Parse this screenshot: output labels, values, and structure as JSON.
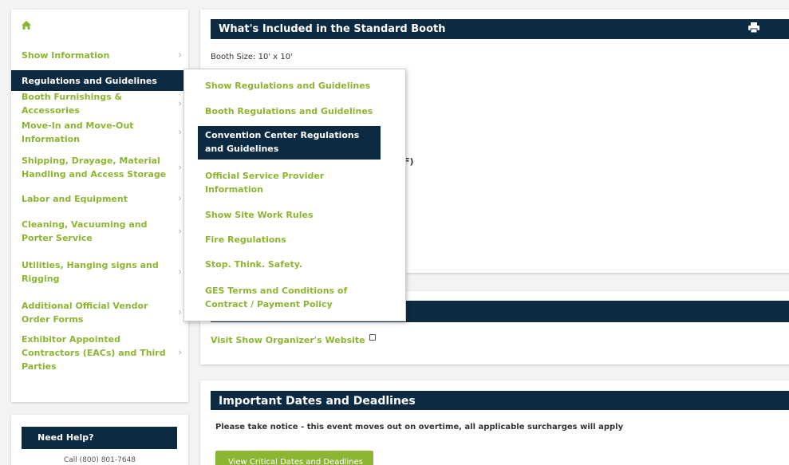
{
  "sidebar": {
    "home_icon": "home-icon",
    "items": [
      {
        "label": "Show Information"
      },
      {
        "label": "Regulations and Guidelines"
      },
      {
        "label": "Booth Furnishings & Accessories"
      },
      {
        "label": "Move-In and Move-Out Information"
      },
      {
        "label": "Shipping, Drayage, Material Handling and Access Storage"
      },
      {
        "label": "Labor and Equipment"
      },
      {
        "label": "Cleaning, Vacuuming and Porter Service"
      },
      {
        "label": "Utilities, Hanging signs and Rigging"
      },
      {
        "label": "Additional Official Vendor Order Forms"
      },
      {
        "label": "Exhibitor Appointed Contractors (EACs) and Third Parties"
      }
    ]
  },
  "help": {
    "title": "Need Help?",
    "phone": "Call (800) 801-7648"
  },
  "booth": {
    "title": "What's Included in the Standard Booth",
    "size": "Booth Size: 10' x 10'",
    "fragment": "F)"
  },
  "organizer": {
    "link": "Visit Show Organizer's Website"
  },
  "dates": {
    "title": "Important Dates and Deadlines",
    "notice": "Please take notice - this event moves out on overtime, all applicable surcharges will apply",
    "button": "View Critical Dates and Deadlines"
  },
  "dropdown": {
    "items": [
      {
        "label": "Show Regulations and Guidelines"
      },
      {
        "label": "Booth Regulations and Guidelines"
      },
      {
        "label": "Convention Center Regulations and Guidelines"
      },
      {
        "label": "Official Service Provider Information"
      },
      {
        "label": "Show Site Work Rules"
      },
      {
        "label": "Fire Regulations"
      },
      {
        "label": "Stop. Think. Safety."
      },
      {
        "label": "GES Terms and Conditions of Contract / Payment Policy"
      }
    ]
  },
  "colors": {
    "navy": "#0d2a43",
    "green": "#8cb531"
  }
}
